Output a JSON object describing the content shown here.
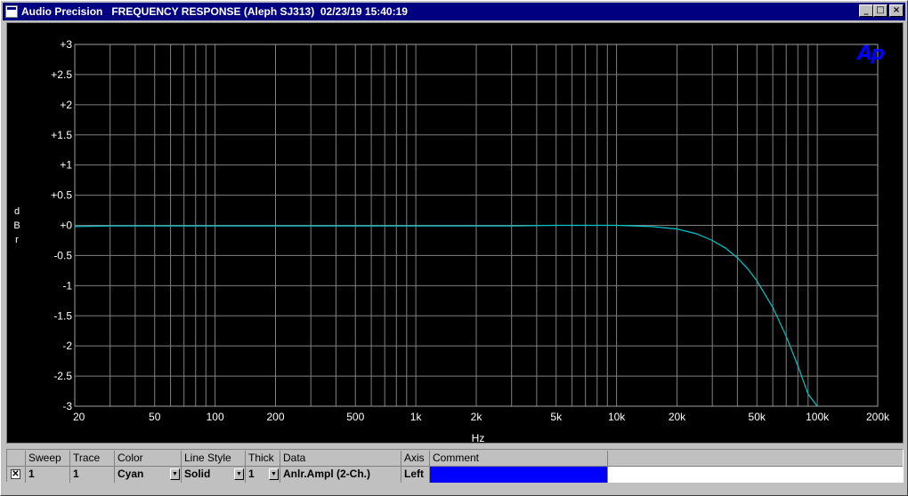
{
  "window": {
    "title": "Audio Precision   FREQUENCY RESPONSE (Aleph SJ313)  02/23/19 15:40:19",
    "minimize_icon": "minimize-icon",
    "maximize_icon": "maximize-icon",
    "close_icon": "close-icon"
  },
  "graph": {
    "logo": "Ap",
    "ylabel_letters": [
      "d",
      "B",
      "r"
    ],
    "xlabel": "Hz",
    "background": "#000000",
    "grid_color": "#808080",
    "trace_color": "#00c8c8"
  },
  "chart_data": {
    "type": "line",
    "title": "FREQUENCY RESPONSE (Aleph SJ313)",
    "xlabel": "Hz",
    "ylabel": "dBr",
    "xscale": "log",
    "xlim": [
      20,
      200000
    ],
    "ylim": [
      -3,
      3
    ],
    "grid": true,
    "yticks": [
      "+3",
      "+2.5",
      "+2",
      "+1.5",
      "+1",
      "+0.5",
      "+0",
      "-0.5",
      "-1",
      "-1.5",
      "-2",
      "-2.5",
      "-3"
    ],
    "xticks": [
      "20",
      "50",
      "100",
      "200",
      "500",
      "1k",
      "2k",
      "5k",
      "10k",
      "20k",
      "50k",
      "100k",
      "200k"
    ],
    "series": [
      {
        "x": [
          20,
          30,
          50,
          100,
          200,
          500,
          1000,
          2000,
          3000,
          5000,
          10000,
          15000,
          20000,
          25000,
          30000,
          35000,
          40000,
          45000,
          50000,
          60000,
          70000,
          80000,
          90000,
          100000
        ],
        "y": [
          -0.02,
          -0.01,
          -0.01,
          -0.01,
          -0.01,
          -0.01,
          -0.01,
          -0.01,
          -0.01,
          0.0,
          0.0,
          -0.02,
          -0.06,
          -0.14,
          -0.25,
          -0.38,
          -0.54,
          -0.72,
          -0.92,
          -1.36,
          -1.84,
          -2.33,
          -2.8,
          -3.0
        ]
      }
    ]
  },
  "table": {
    "headers": [
      "Sweep",
      "Trace",
      "Color",
      "Line Style",
      "Thick",
      "Data",
      "Axis",
      "Comment"
    ],
    "row": {
      "checked": "✕",
      "sweep": "1",
      "trace": "1",
      "color": "Cyan",
      "line_style": "Solid",
      "thick": "1",
      "data": "Anlr.Ampl (2-Ch.)",
      "axis": "Left",
      "comment": ""
    },
    "comment_color": "#0000ff"
  }
}
